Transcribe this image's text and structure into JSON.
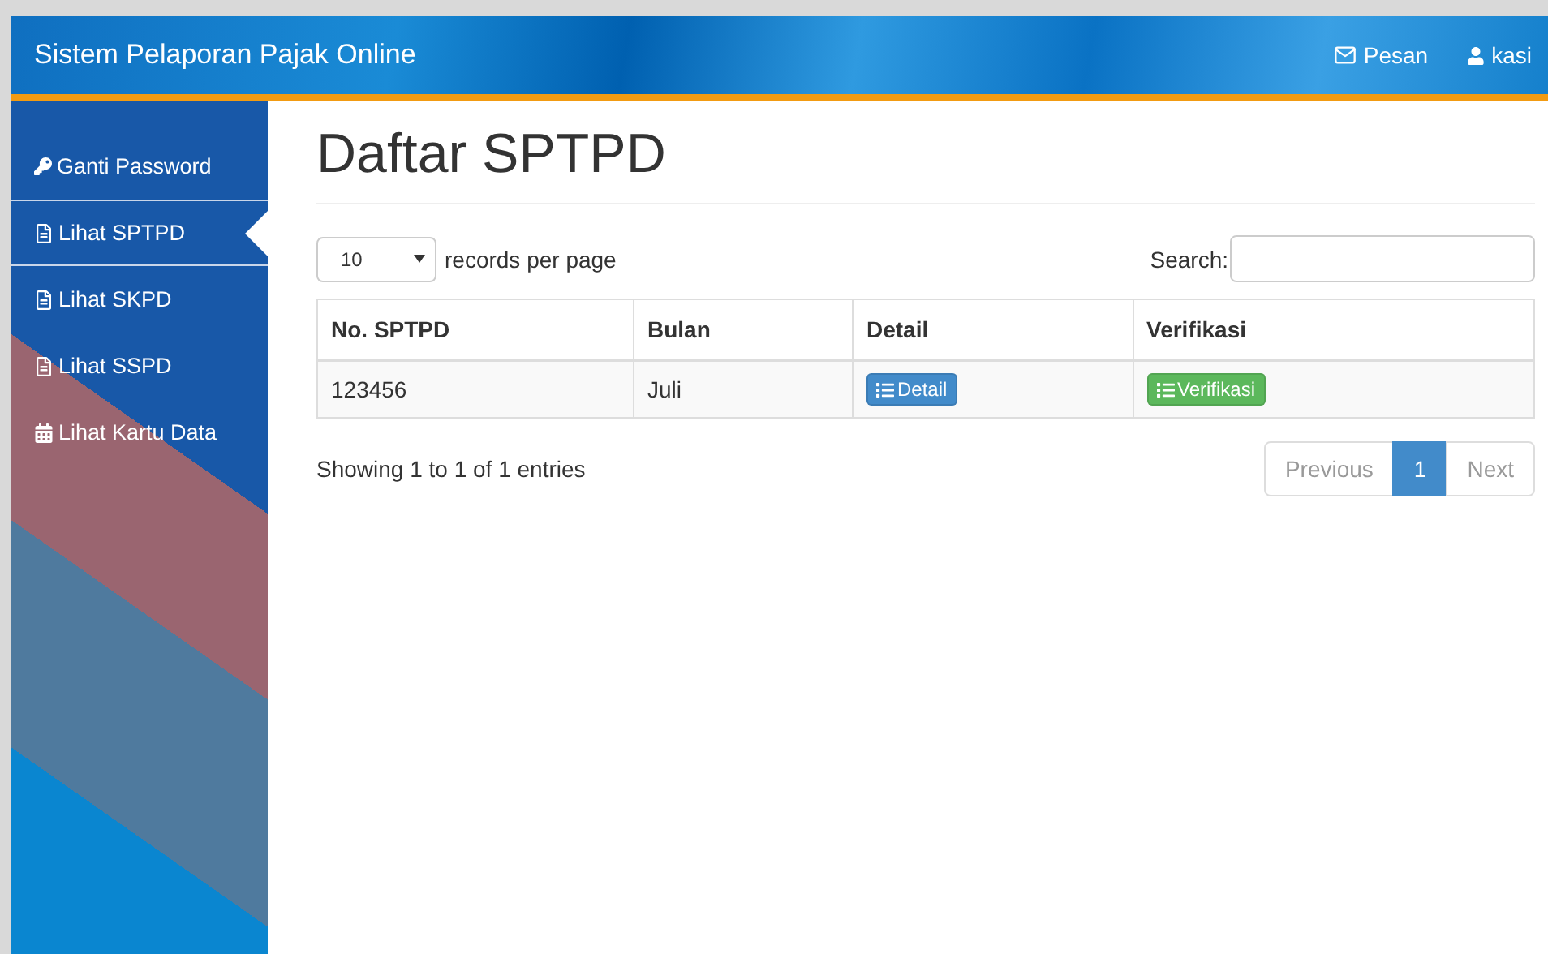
{
  "navbar": {
    "brand": "Sistem Pelaporan Pajak Online",
    "menus": [
      {
        "kind": "mail",
        "label": "Pesan"
      },
      {
        "kind": "user",
        "label": "kasi"
      }
    ]
  },
  "sidebar": {
    "items": [
      {
        "kind": "key",
        "label": "Ganti Password",
        "selected": false
      },
      {
        "kind": "file",
        "label": "Lihat SPTPD",
        "selected": true
      },
      {
        "kind": "file",
        "label": "Lihat SKPD",
        "selected": false
      },
      {
        "kind": "file",
        "label": "Lihat SSPD",
        "selected": false
      },
      {
        "kind": "calendar",
        "label": "Lihat Kartu Data",
        "selected": false
      }
    ]
  },
  "page": {
    "title": "Daftar SPTPD",
    "page_size": "10",
    "page_size_label": "records per page",
    "search_label": "Search:",
    "table": {
      "columns": [
        "No. SPTPD",
        "Bulan",
        "Detail",
        "Verifikasi"
      ],
      "rows": [
        {
          "number": "123456",
          "month": "Juli",
          "detail_button": "Detail",
          "verify_button": "Verifikasi"
        }
      ]
    },
    "info": "Showing 1 to 1 of 1 entries",
    "pagination": [
      {
        "label": "Previous",
        "selected": false
      },
      {
        "label": "1",
        "selected": true
      },
      {
        "label": "Next",
        "selected": false
      }
    ]
  }
}
